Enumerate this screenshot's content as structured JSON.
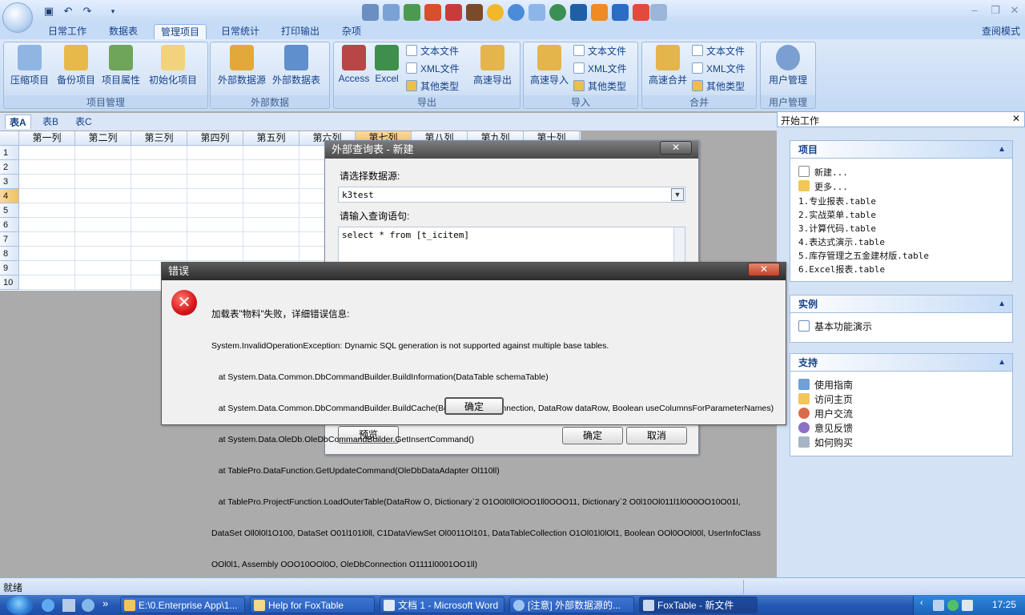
{
  "window": {
    "tabs": [
      {
        "label": "日常工作"
      },
      {
        "label": "数据表"
      },
      {
        "label": "管理项目",
        "active": true
      },
      {
        "label": "日常统计"
      },
      {
        "label": "打印输出"
      },
      {
        "label": "杂项"
      }
    ],
    "read_mode": "查阅模式",
    "quick_access": [
      "save-icon",
      "undo-icon",
      "redo-icon",
      "customize-icon"
    ]
  },
  "ribbon": {
    "project": {
      "label": "项目管理",
      "buttons": [
        "压缩项目",
        "备份项目",
        "项目属性",
        "初始化项目"
      ]
    },
    "external": {
      "label": "外部数据",
      "buttons": [
        "外部数据源",
        "外部数据表"
      ]
    },
    "export": {
      "label": "导出",
      "buttons": [
        "Access",
        "Excel"
      ],
      "small": [
        "文本文件",
        "XML文件",
        "其他类型"
      ],
      "fast": "高速导出"
    },
    "import": {
      "label": "导入",
      "fast": "高速导入",
      "small": [
        "文本文件",
        "XML文件",
        "其他类型"
      ]
    },
    "merge": {
      "label": "合并",
      "fast": "高速合并",
      "small": [
        "文本文件",
        "XML文件",
        "其他类型"
      ]
    },
    "users": {
      "label": "用户管理",
      "button": "用户管理"
    }
  },
  "sheet": {
    "tabs": [
      "表A",
      "表B",
      "表C"
    ],
    "columns": [
      "第一列",
      "第二列",
      "第三列",
      "第四列",
      "第五列",
      "第六列",
      "第七列",
      "第八列",
      "第九列",
      "第十列"
    ],
    "rows": [
      "1",
      "2",
      "3",
      "4",
      "5",
      "6",
      "7",
      "8",
      "9",
      "10"
    ],
    "selected_column": "第七列",
    "selected_row": "4"
  },
  "taskpane": {
    "title": "开始工作",
    "close": "✕",
    "project": {
      "title": "项目",
      "new": "新建...",
      "more": "更多...",
      "recent": [
        "1.专业报表.table",
        "2.实战菜单.table",
        "3.计算代码.table",
        "4.表达式演示.table",
        "5.库存管理之五金建材版.table",
        "6.Excel报表.table"
      ]
    },
    "examples": {
      "title": "实例",
      "items": [
        "基本功能演示"
      ]
    },
    "support": {
      "title": "支持",
      "items": [
        "使用指南",
        "访问主页",
        "用户交流",
        "意见反馈",
        "如何购买"
      ]
    }
  },
  "query_dialog": {
    "title": "外部查询表 - 新建",
    "source_label": "请选择数据源:",
    "source_value": "k3test",
    "sql_label": "请输入查询语句:",
    "sql_value": "select * from [t_icitem]",
    "preview": "预览",
    "ok": "确定",
    "cancel": "取消"
  },
  "error_dialog": {
    "title": "错误",
    "lines": [
      "加载表\"物料\"失败，详细错误信息:",
      "System.InvalidOperationException: Dynamic SQL generation is not supported against multiple base tables.",
      "   at System.Data.Common.DbCommandBuilder.BuildInformation(DataTable schemaTable)",
      "   at System.Data.Common.DbCommandBuilder.BuildCache(Boolean closeConnection, DataRow dataRow, Boolean useColumnsForParameterNames)",
      "   at System.Data.OleDb.OleDbCommandBuilder.GetInsertCommand()",
      "   at TablePro.DataFunction.GetUpdateCommand(OleDbDataAdapter Ol110ll)",
      "   at TablePro.ProjectFunction.LoadOuterTable(DataRow O, Dictionary`2 O1O0l0llOlOO1ll0OOO11, Dictionary`2 O0l10Ol011l1l0O0OO10O01l,",
      "DataSet Oll0l0l1O100, DataSet O01l101l0ll, C1DataViewSet Ol0011Ol101, DataTableCollection O1Ol01l0lOl1, Boolean OOl0OOl00l, UserInfoClass",
      "OOl0l1, Assembly OOO10OOl0O, OleDbConnection O1111l0001OO1ll)"
    ],
    "ok": "确定"
  },
  "status": {
    "text": "就绪"
  },
  "taskbar": {
    "items": [
      {
        "label": "E:\\0.Enterprise App\\1..."
      },
      {
        "label": "Help for FoxTable"
      },
      {
        "label": "文档 1 - Microsoft Word"
      },
      {
        "label": "[注意] 外部数据源的..."
      },
      {
        "label": "FoxTable - 新文件",
        "active": true
      }
    ],
    "more": "»",
    "clock": "17:25"
  },
  "colors": {
    "accent": "#15428b",
    "selection": "#f1c15f",
    "error": "#d7151b"
  }
}
